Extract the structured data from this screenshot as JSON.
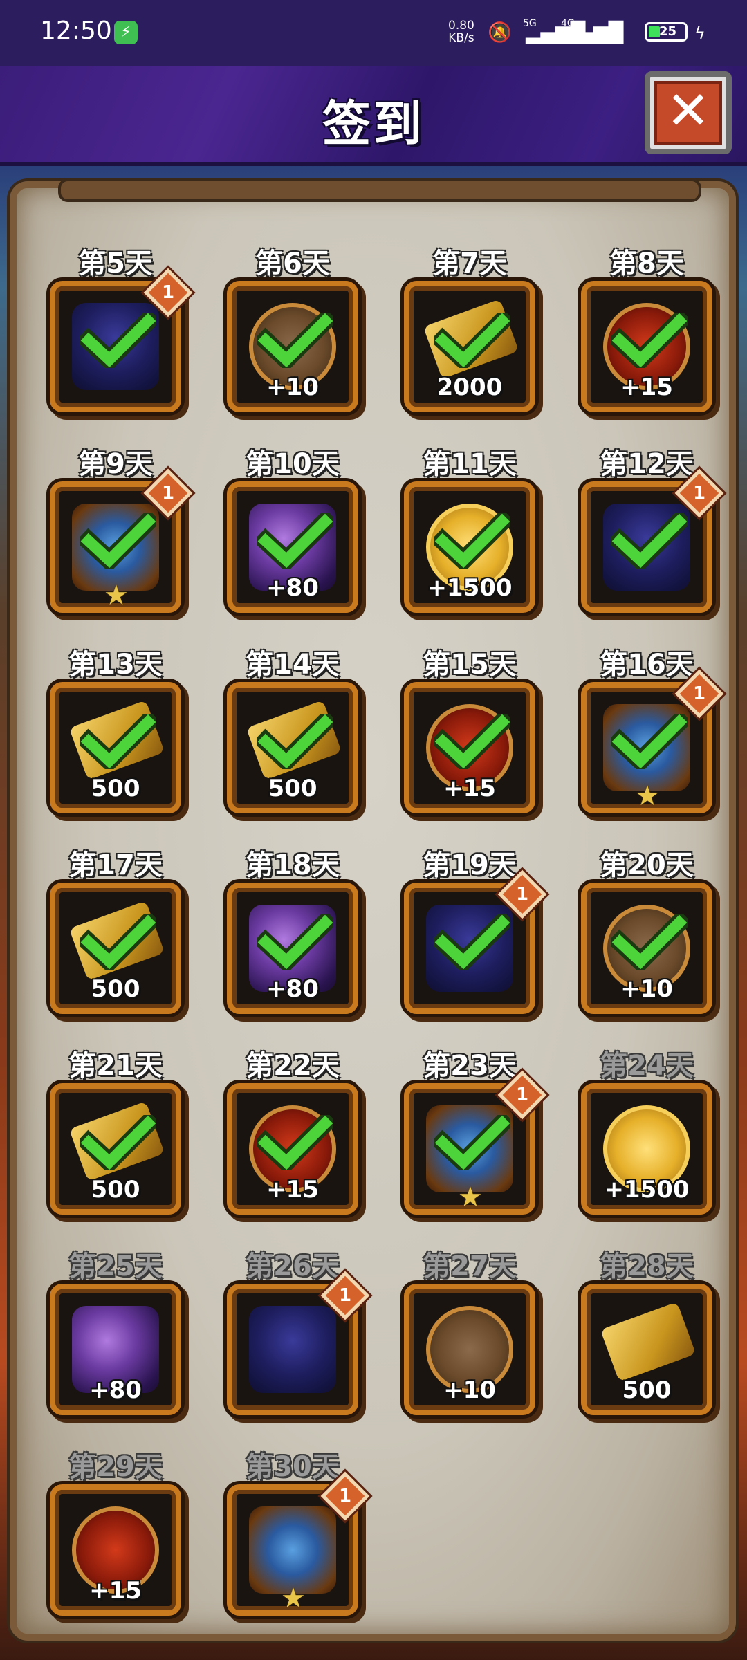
{
  "status_bar": {
    "time": "12:50",
    "net_speed": "0.80\nKB/s",
    "net_1": "5G",
    "net_2": "4G",
    "battery": "25"
  },
  "header": {
    "title": "签到",
    "close_label": "✕"
  },
  "days": [
    {
      "label": "第5天",
      "item": "demon",
      "amount": "",
      "claimed": true,
      "badge": "1",
      "star": false
    },
    {
      "label": "第6天",
      "item": "anvil",
      "amount": "+10",
      "claimed": true,
      "badge": "",
      "star": false
    },
    {
      "label": "第7天",
      "item": "gold",
      "amount": "2000",
      "claimed": true,
      "badge": "",
      "star": false
    },
    {
      "label": "第8天",
      "item": "skull",
      "amount": "+15",
      "claimed": true,
      "badge": "",
      "star": false
    },
    {
      "label": "第9天",
      "item": "gauntlet",
      "amount": "",
      "claimed": true,
      "badge": "1",
      "star": true
    },
    {
      "label": "第10天",
      "item": "galaxy",
      "amount": "+80",
      "claimed": true,
      "badge": "",
      "star": false
    },
    {
      "label": "第11天",
      "item": "coin",
      "amount": "+1500",
      "claimed": true,
      "badge": "",
      "star": false
    },
    {
      "label": "第12天",
      "item": "demon",
      "amount": "",
      "claimed": true,
      "badge": "1",
      "star": false
    },
    {
      "label": "第13天",
      "item": "gold",
      "amount": "500",
      "claimed": true,
      "badge": "",
      "star": false
    },
    {
      "label": "第14天",
      "item": "gold",
      "amount": "500",
      "claimed": true,
      "badge": "",
      "star": false
    },
    {
      "label": "第15天",
      "item": "skull",
      "amount": "+15",
      "claimed": true,
      "badge": "",
      "star": false
    },
    {
      "label": "第16天",
      "item": "gauntlet",
      "amount": "",
      "claimed": true,
      "badge": "1",
      "star": true
    },
    {
      "label": "第17天",
      "item": "gold",
      "amount": "500",
      "claimed": true,
      "badge": "",
      "star": false
    },
    {
      "label": "第18天",
      "item": "galaxy",
      "amount": "+80",
      "claimed": true,
      "badge": "",
      "star": false
    },
    {
      "label": "第19天",
      "item": "demon",
      "amount": "",
      "claimed": true,
      "badge": "1",
      "star": false
    },
    {
      "label": "第20天",
      "item": "anvil",
      "amount": "+10",
      "claimed": true,
      "badge": "",
      "star": false
    },
    {
      "label": "第21天",
      "item": "gold",
      "amount": "500",
      "claimed": true,
      "badge": "",
      "star": false
    },
    {
      "label": "第22天",
      "item": "skull",
      "amount": "+15",
      "claimed": true,
      "badge": "",
      "star": false
    },
    {
      "label": "第23天",
      "item": "gauntlet",
      "amount": "",
      "claimed": true,
      "badge": "1",
      "star": true
    },
    {
      "label": "第24天",
      "item": "coin",
      "amount": "+1500",
      "claimed": false,
      "badge": "",
      "star": false
    },
    {
      "label": "第25天",
      "item": "galaxy",
      "amount": "+80",
      "claimed": false,
      "badge": "",
      "star": false
    },
    {
      "label": "第26天",
      "item": "demon",
      "amount": "",
      "claimed": false,
      "badge": "1",
      "star": false
    },
    {
      "label": "第27天",
      "item": "anvil",
      "amount": "+10",
      "claimed": false,
      "badge": "",
      "star": false
    },
    {
      "label": "第28天",
      "item": "gold",
      "amount": "500",
      "claimed": false,
      "badge": "",
      "star": false
    },
    {
      "label": "第29天",
      "item": "skull",
      "amount": "+15",
      "claimed": false,
      "badge": "",
      "star": false
    },
    {
      "label": "第30天",
      "item": "gauntlet",
      "amount": "",
      "claimed": false,
      "badge": "1",
      "star": true
    }
  ],
  "colors": {
    "check_green": "#4cd43a",
    "frame_gold": "#c97a1e",
    "label_claimed": "#ffffff",
    "label_future": "#9a9a9a"
  }
}
